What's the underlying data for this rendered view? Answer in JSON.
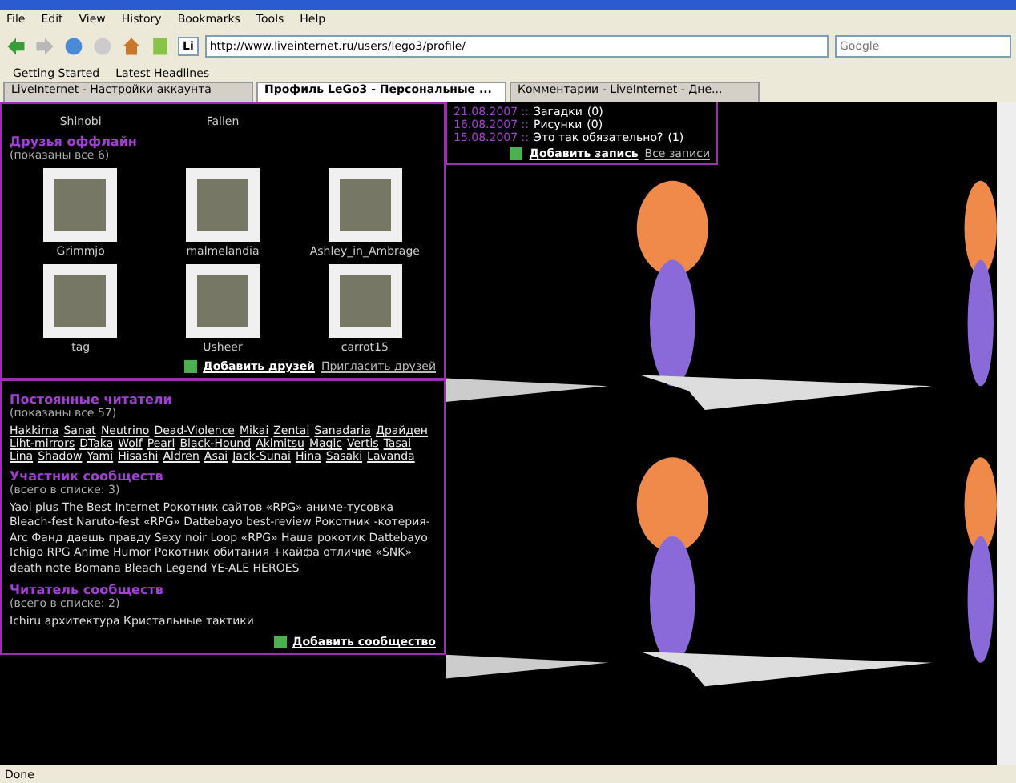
{
  "menu": [
    "File",
    "Edit",
    "View",
    "History",
    "Bookmarks",
    "Tools",
    "Help"
  ],
  "address": {
    "site_icon": "Li",
    "value": "http://www.liveinternet.ru/users/lego3/profile/"
  },
  "search": {
    "placeholder": "Google"
  },
  "bookmarks": [
    "Getting Started",
    "Latest Headlines"
  ],
  "tabs": [
    {
      "label": "LiveInternet - Настройки аккаунта",
      "selected": false
    },
    {
      "label": "Профиль LeGo3 - Персональные ...",
      "selected": true
    },
    {
      "label": "Комментарии - LiveInternet - Дне...",
      "selected": false
    }
  ],
  "friends_online_tail": [
    "Shinobi",
    "Fallen"
  ],
  "friends_offline": {
    "title": "Друзья оффлайн",
    "count": "(показаны все 6)",
    "items": [
      "Grimmjo",
      "malmelandia",
      "Ashley_in_Ambrage",
      "tag",
      "Usheer",
      "carrot15"
    ],
    "links": [
      "Добавить друзей",
      "Пригласить друзей"
    ]
  },
  "readers": {
    "title": "Постоянные читатели",
    "count": "(показаны все 57)",
    "names": [
      "Hakkima",
      "Sanat",
      "Neutrino",
      "Dead-Violence",
      "Mikai",
      "Zentai",
      "Sanadaria",
      "Драйден",
      "Liht-mirrors",
      "DTaka",
      "Wolf",
      "Pearl",
      "Black-Hound",
      "Akimitsu",
      "Magic",
      "Vertis",
      "Tasai",
      "Lina",
      "Shadow",
      "Yami",
      "Hisashi",
      "Aldren",
      "Asai",
      "Jack-Sunai",
      "Hina",
      "Sasaki",
      "Lavanda"
    ]
  },
  "member": {
    "title": "Участник сообществ",
    "count": "(всего в списке: 3)",
    "text": "Yaoi plus The Best Internet Рокотник сайтов «RPG» аниме-тусовка Bleach-fest Naruto-fest «RPG» Dattebayo best-review Рокотник -котерия- Arc Фанд даешь правду Sexy noir Loop «RPG» Наша рокотик Dattebayo Ichigo RPG Anime Humor Рокотник обитания +кайфа отличие «SNK» death note Bomana Bleach Legend YE-ALE HEROES"
  },
  "reader_of": {
    "title": "Читатель сообществ",
    "count": "(всего в списке: 2)",
    "text": "Ichiru архитектура Кристальные тактики",
    "link": "Добавить сообщество"
  },
  "posts": {
    "entries": [
      {
        "date": "21.08.2007 ::",
        "title": "Загадки",
        "count": "(0)"
      },
      {
        "date": "16.08.2007 ::",
        "title": "Рисунки",
        "count": "(0)"
      },
      {
        "date": "15.08.2007 ::",
        "title": "Это так обязательно?",
        "count": "(1)"
      }
    ],
    "links": [
      "Добавить запись",
      "Все записи"
    ]
  },
  "status": "Done"
}
